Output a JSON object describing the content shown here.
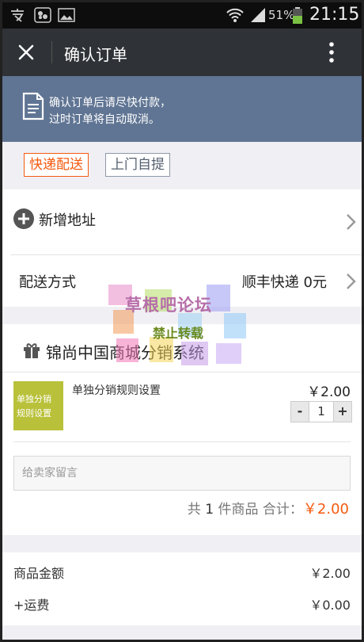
{
  "status_bar": {
    "left_icons": [
      "app-icon",
      "shield-app-icon",
      "gallery-icon"
    ],
    "right_icons": [
      "wifi-icon",
      "signal-icon",
      "battery-icon"
    ],
    "battery": "51%",
    "time": "21:15"
  },
  "title_bar": {
    "title": "确认订单",
    "close_icon": "close-icon",
    "more_icon": "more-vertical-icon"
  },
  "notice": {
    "icon": "document-icon",
    "line1": "确认订单后请尽快付款，",
    "line2": "过时订单将自动取消。"
  },
  "delivery_tabs": {
    "express": "快递配送",
    "pickup": "上门自提"
  },
  "address": {
    "label": "新增地址",
    "icon": "add-circle-icon"
  },
  "shipping": {
    "label": "配送方式",
    "value": "顺丰快递 0元"
  },
  "store": {
    "icon": "gift-icon",
    "name": "锦尚中国商城分销系统"
  },
  "product": {
    "thumb_line1": "单独分销",
    "thumb_line2": "规则设置",
    "name": "单独分销规则设置",
    "price": "￥2.00",
    "qty": "1",
    "minus": "-",
    "plus": "+"
  },
  "message": {
    "placeholder": "给卖家留言",
    "value": ""
  },
  "order_summary": {
    "prefix": "共",
    "count": "1",
    "middle": "件商品 合计：",
    "total": "￥2.00"
  },
  "totals": {
    "goods_label": "商品金额",
    "goods_value": "￥2.00",
    "freight_label": "+运费",
    "freight_value": "￥0.00"
  },
  "watermark": {
    "line1": "草根吧论坛",
    "line2": "禁止转载"
  },
  "colors": {
    "accent": "#f55a0f",
    "title_bar": "#2f3236",
    "notice_bg": "#607593",
    "page_bg": "#efeff4"
  }
}
